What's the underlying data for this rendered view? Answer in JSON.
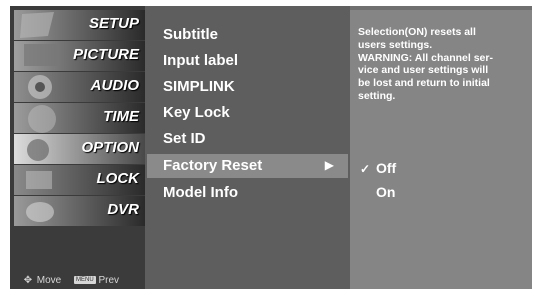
{
  "categories": [
    {
      "label": "SETUP"
    },
    {
      "label": "PICTURE"
    },
    {
      "label": "AUDIO"
    },
    {
      "label": "TIME"
    },
    {
      "label": "OPTION",
      "active": true
    },
    {
      "label": "LOCK"
    },
    {
      "label": "DVR"
    }
  ],
  "nav_hint": {
    "move": "Move",
    "menu_key": "MENU",
    "prev": "Prev"
  },
  "menu_items": [
    {
      "label": "Subtitle"
    },
    {
      "label": "Input label"
    },
    {
      "label": "SIMPLINK"
    },
    {
      "label": "Key Lock"
    },
    {
      "label": "Set ID"
    },
    {
      "label": "Factory Reset",
      "selected": true
    },
    {
      "label": "Model Info"
    }
  ],
  "info": {
    "text": "Selection(ON) resets all\nusers settings.\n WARNING: All channel ser-\nvice and user settings will\nbe lost and return to initial\nsetting."
  },
  "options": [
    {
      "label": "Off",
      "checked": true
    },
    {
      "label": "On",
      "checked": false
    }
  ],
  "icons": {
    "move": "four-way-arrow-icon",
    "submenu_arrow": "right-triangle-icon",
    "check": "checkmark-icon"
  }
}
